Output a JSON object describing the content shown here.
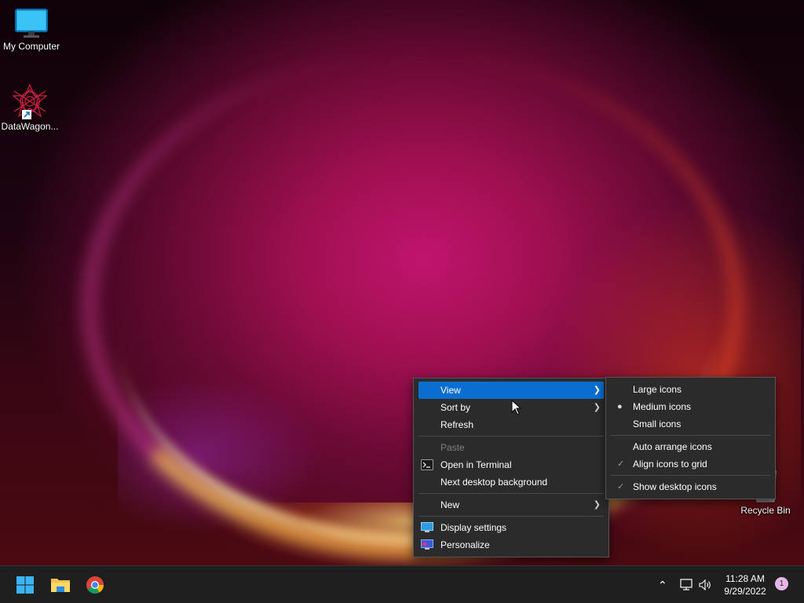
{
  "desktop": {
    "icons": [
      {
        "label": "My Computer",
        "icon": "monitor-icon"
      },
      {
        "label": "DataWagon...",
        "icon": "star-shortcut-icon"
      },
      {
        "label": "Recycle Bin",
        "icon": "recycle-bin-icon"
      }
    ]
  },
  "context_menu": {
    "items": [
      {
        "label": "View",
        "submenu": true,
        "highlighted": true
      },
      {
        "label": "Sort by",
        "submenu": true
      },
      {
        "label": "Refresh"
      },
      {
        "label": "Paste",
        "disabled": true
      },
      {
        "label": "Open in Terminal",
        "icon": "terminal-icon"
      },
      {
        "label": "Next desktop background"
      },
      {
        "label": "New",
        "submenu": true
      },
      {
        "label": "Display settings",
        "icon": "display-icon"
      },
      {
        "label": "Personalize",
        "icon": "personalize-icon"
      }
    ]
  },
  "view_submenu": {
    "items": [
      {
        "label": "Large icons"
      },
      {
        "label": "Medium icons",
        "selected": true
      },
      {
        "label": "Small icons"
      },
      {
        "label": "Auto arrange icons",
        "checked": false
      },
      {
        "label": "Align icons to grid",
        "checked": true
      },
      {
        "label": "Show desktop icons",
        "checked": true
      }
    ]
  },
  "taskbar": {
    "apps": [
      {
        "name": "start-button",
        "icon": "windows-logo-icon"
      },
      {
        "name": "file-explorer",
        "icon": "folder-icon"
      },
      {
        "name": "chrome",
        "icon": "chrome-icon"
      }
    ],
    "tray": {
      "time": "11:28 AM",
      "date": "9/29/2022",
      "notification_count": "1"
    }
  },
  "colors": {
    "accent": "#0a6ed1",
    "menu_bg": "#2b2b2b",
    "taskbar_bg": "#1f1f1f"
  }
}
